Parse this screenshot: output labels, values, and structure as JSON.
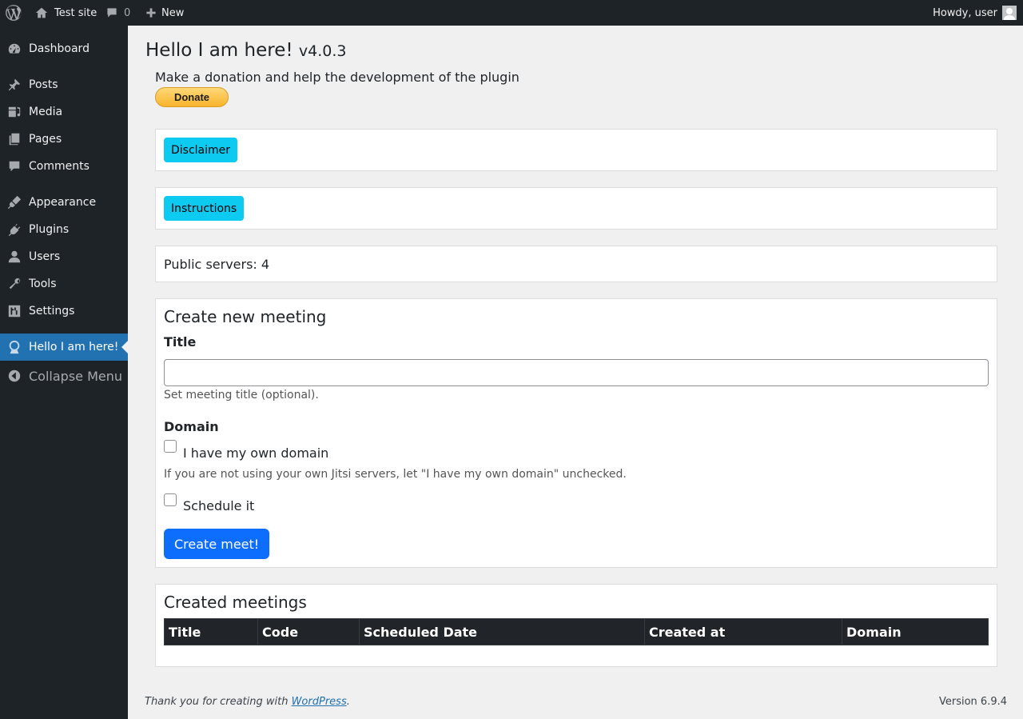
{
  "admin_bar": {
    "site_name": "Test site",
    "comments_count": "0",
    "new_label": "New",
    "howdy": "Howdy, user"
  },
  "sidebar": {
    "items": [
      {
        "label": "Dashboard",
        "icon": "dashboard-icon"
      },
      {
        "label": "Posts",
        "icon": "pin-icon"
      },
      {
        "label": "Media",
        "icon": "media-icon"
      },
      {
        "label": "Pages",
        "icon": "pages-icon"
      },
      {
        "label": "Comments",
        "icon": "comment-icon"
      },
      {
        "label": "Appearance",
        "icon": "brush-icon"
      },
      {
        "label": "Plugins",
        "icon": "plug-icon"
      },
      {
        "label": "Users",
        "icon": "user-icon"
      },
      {
        "label": "Tools",
        "icon": "wrench-icon"
      },
      {
        "label": "Settings",
        "icon": "settings-icon"
      },
      {
        "label": "Hello I am here!",
        "icon": "plugin-logo-icon",
        "current": true
      }
    ],
    "collapse_label": "Collapse Menu"
  },
  "page": {
    "title": "Hello I am here!",
    "version": "v4.0.3",
    "donate_text": "Make a donation and help the development of the plugin",
    "donate_button": "Donate",
    "disclaimer_button": "Disclaimer",
    "instructions_button": "Instructions",
    "public_servers": "Public servers: 4"
  },
  "create_meeting": {
    "heading": "Create new meeting",
    "title_label": "Title",
    "title_value": "",
    "title_help": "Set meeting title (optional).",
    "domain_label": "Domain",
    "own_domain_label": "I have my own domain",
    "own_domain_help": "If you are not using your own Jitsi servers, let \"I have my own domain\" unchecked.",
    "schedule_label": "Schedule it",
    "submit_label": "Create meet!"
  },
  "created_meetings": {
    "heading": "Created meetings",
    "columns": [
      "Title",
      "Code",
      "Scheduled Date",
      "Created at",
      "Domain"
    ]
  },
  "footer": {
    "thanks_prefix": "Thank you for creating with ",
    "link_text": "WordPress",
    "thanks_suffix": ".",
    "version": "Version 6.9.4"
  },
  "colors": {
    "admin_dark": "#1d2327",
    "accent": "#2271b1",
    "info_button": "#0dcaf0",
    "primary_button": "#0d6efd"
  }
}
